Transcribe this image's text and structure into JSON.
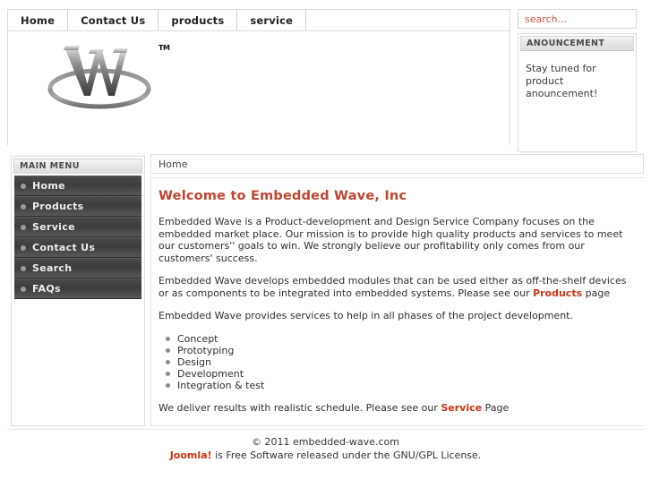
{
  "nav": {
    "items": [
      {
        "label": "Home"
      },
      {
        "label": "Contact Us"
      },
      {
        "label": "products"
      },
      {
        "label": "service"
      }
    ]
  },
  "logo": {
    "letter": "W",
    "trademark": "TM"
  },
  "search": {
    "placeholder": "search...",
    "value": ""
  },
  "announcement": {
    "title": "ANOUNCEMENT",
    "body": "Stay tuned for product anouncement!"
  },
  "sidebar": {
    "title": "MAIN MENU",
    "items": [
      {
        "label": "Home"
      },
      {
        "label": "Products"
      },
      {
        "label": "Service"
      },
      {
        "label": "Contact Us"
      },
      {
        "label": "Search"
      },
      {
        "label": "FAQs"
      }
    ]
  },
  "breadcrumb": {
    "current": "Home"
  },
  "content": {
    "title": "Welcome to Embedded Wave, Inc",
    "para1": "Embedded Wave is a Product-development and Design Service Company focuses on the embedded market place. Our   mission is to provide high quality products and services to meet our customers'' goals to win. We strongly believe our profitability only comes from our customers' success.",
    "para2_before": "Embedded Wave develops embedded modules that can be used either as off-the-shelf devices or as components to be integrated into embedded systems.  Please see our ",
    "para2_link": "Products",
    "para2_after": " page",
    "para3": "Embedded Wave provides services to help in all phases of the project development.",
    "bullets": [
      {
        "label": "Concept"
      },
      {
        "label": "Prototyping"
      },
      {
        "label": "Design"
      },
      {
        "label": "Development"
      },
      {
        "label": "Integration &  test"
      }
    ],
    "para4_before": "We deliver results with realistic schedule. Please see our ",
    "para4_link": "Service",
    "para4_after": " Page"
  },
  "footer": {
    "copyright": "© 2011 embedded-wave.com",
    "joomla": "Joomla!",
    "license": " is Free Software released under the GNU/GPL License."
  },
  "colors": {
    "accent_red": "#cc3311",
    "title_red": "#c0452f",
    "menu_dark": "#3c3c3e"
  }
}
